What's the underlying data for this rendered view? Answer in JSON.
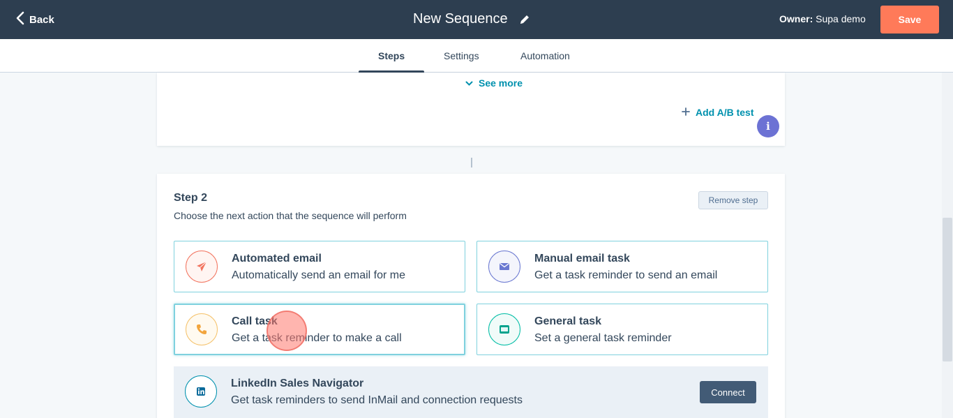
{
  "header": {
    "back_label": "Back",
    "title": "New Sequence",
    "owner_label": "Owner:",
    "owner_name": "Supa demo",
    "save_label": "Save"
  },
  "tabs": [
    {
      "label": "Steps",
      "active": true
    },
    {
      "label": "Settings",
      "active": false
    },
    {
      "label": "Automation",
      "active": false
    }
  ],
  "step1": {
    "see_more": "See more",
    "add_ab_test": "Add A/B test"
  },
  "info_badge": "i",
  "step2": {
    "title": "Step 2",
    "description": "Choose the next action that the sequence will perform",
    "remove_label": "Remove step",
    "options": [
      {
        "title": "Automated email",
        "desc": "Automatically send an email for me",
        "icon": "paper-plane-icon",
        "color": "#f2745f"
      },
      {
        "title": "Manual email task",
        "desc": "Get a task reminder to send an email",
        "icon": "envelope-icon",
        "color": "#6a78d1"
      },
      {
        "title": "Call task",
        "desc": "Get a task reminder to make a call",
        "icon": "phone-icon",
        "color": "#f5c26b"
      },
      {
        "title": "General task",
        "desc": "Set a general task reminder",
        "icon": "task-icon",
        "color": "#00bda5"
      }
    ],
    "linkedin": {
      "title": "LinkedIn Sales Navigator",
      "desc": "Get task reminders to send InMail and connection requests",
      "connect_label": "Connect",
      "icon": "linkedin-icon",
      "color": "#0091ae"
    }
  },
  "colors": {
    "header_bg": "#2d3e50",
    "save_bg": "#ff7a59",
    "link": "#0091ae",
    "option_border": "#7fd1de"
  }
}
